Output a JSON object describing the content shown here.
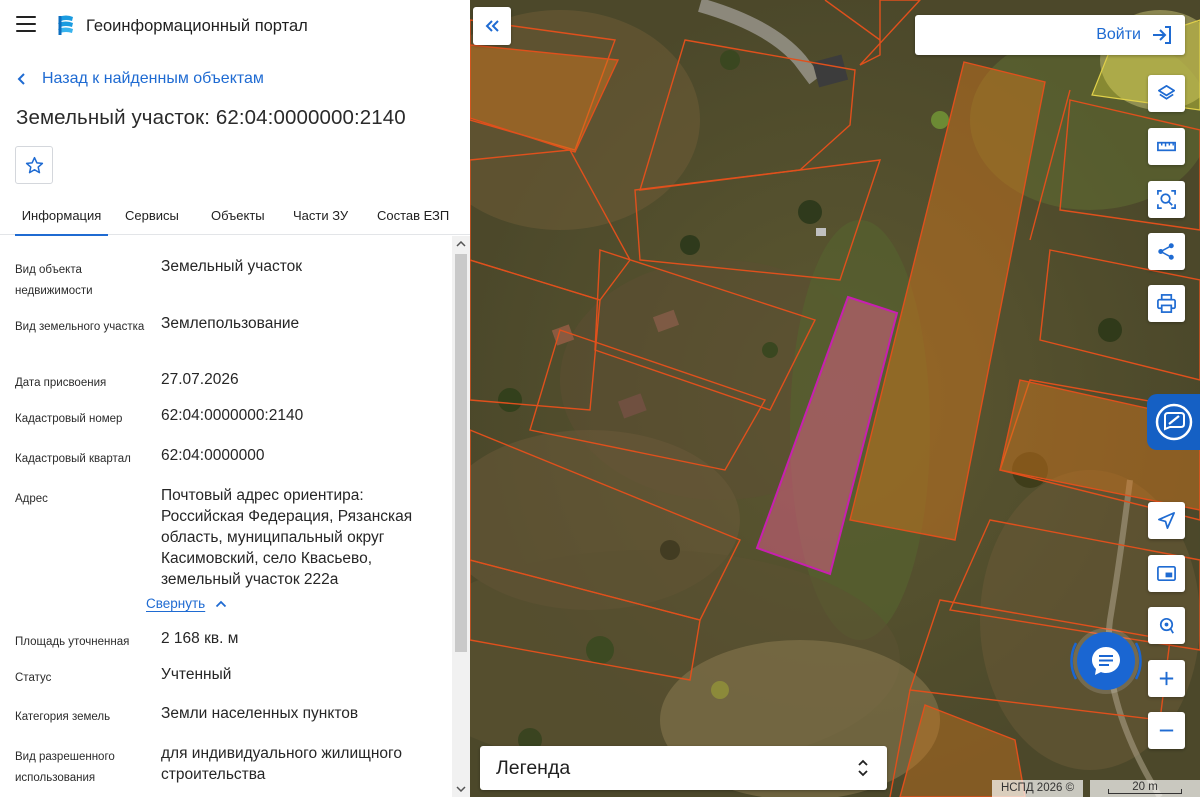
{
  "header": {
    "menu_icon": "hamburger-icon",
    "logo_icon": "portal-logo",
    "title": "Геоинформационный портал"
  },
  "navigation": {
    "back_label": "Назад к найденным объектам"
  },
  "object": {
    "title": "Земельный участок: 62:04:0000000:2140"
  },
  "tabs": [
    {
      "label": "Информация",
      "active": true
    },
    {
      "label": "Сервисы",
      "active": false
    },
    {
      "label": "Объекты",
      "active": false
    },
    {
      "label": "Части ЗУ",
      "active": false
    },
    {
      "label": "Состав ЕЗП",
      "active": false
    }
  ],
  "properties": [
    {
      "label": "Вид объекта недвижимости",
      "value": "Земельный участок"
    },
    {
      "label": "Вид земельного участка",
      "value": "Землепользование"
    },
    {
      "label": "Дата присвоения",
      "value": "27.07.2026"
    },
    {
      "label": "Кадастровый номер",
      "value": "62:04:0000000:2140"
    },
    {
      "label": "Кадастровый квартал",
      "value": "62:04:0000000"
    },
    {
      "label": "Адрес",
      "value": "Почтовый адрес ориентира: Российская Федерация, Рязанская область, муниципальный округ Касимовский, село Квасьево, земельный участок 222а"
    },
    {
      "label": "Площадь уточненная",
      "value": "2 168 кв. м"
    },
    {
      "label": "Статус",
      "value": "Учтенный"
    },
    {
      "label": "Категория земель",
      "value": "Земли населенных пунктов"
    },
    {
      "label": "Вид разрешенного использования",
      "value": "для индивидуального жилищного строительства"
    }
  ],
  "address_collapse_label": "Свернуть",
  "map": {
    "login_label": "Войти",
    "tools": [
      "layers-icon",
      "ruler-icon",
      "area-search-icon",
      "share-icon",
      "print-icon"
    ],
    "nav_tools": [
      "locate-icon",
      "minimap-icon",
      "search-location-icon"
    ],
    "legend_label": "Легенда",
    "copyright": "НСПД 2026 ©",
    "scale_label": "20 m",
    "colors": {
      "accent": "#1f6bd2",
      "parcel_border": "#e0501c",
      "selected_parcel": "#c81fb0",
      "highlight_fill": "#d8781c"
    }
  }
}
